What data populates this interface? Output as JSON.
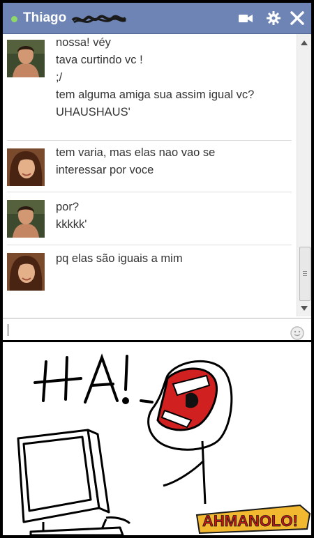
{
  "chat": {
    "contact_name": "Thiago",
    "status_color": "#8ed86b",
    "header_color": "#6d84b4",
    "header_icons": [
      "video-camera-icon",
      "gear-icon",
      "close-icon"
    ],
    "messages": [
      {
        "sender": "contact",
        "lines": [
          "nossa! véy",
          "tava curtindo vc !",
          ";/",
          "tem alguma amiga sua assim igual vc?",
          "UHAUSHAUS'"
        ]
      },
      {
        "sender": "user",
        "lines": [
          "tem varia, mas elas nao vao se",
          "interessar por voce"
        ]
      },
      {
        "sender": "contact",
        "lines": [
          "por?",
          "kkkkk'"
        ]
      },
      {
        "sender": "user",
        "lines": [
          "pq elas são iguais a mim"
        ]
      }
    ],
    "input": {
      "value": "",
      "placeholder": ""
    },
    "emoji_icon": "smiley-icon"
  },
  "comic": {
    "exclamation": "HA!",
    "logo_text": "AHMANOLO!"
  }
}
